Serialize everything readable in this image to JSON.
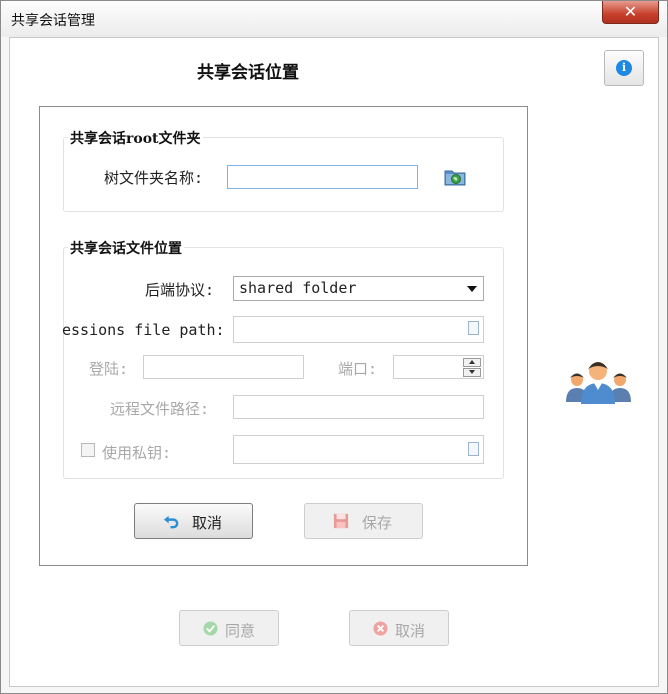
{
  "window": {
    "title": "共享会话管理",
    "close_glyph": "✕"
  },
  "heading": "共享会话位置",
  "info_button": {
    "icon": "info-icon",
    "glyph": "i"
  },
  "root_group": {
    "legend": "共享会话root文件夹",
    "tree_label": "树文件夹名称:",
    "tree_value": "",
    "browse_icon": "folder-globe-icon"
  },
  "location_group": {
    "legend": "共享会话文件位置",
    "backend_label": "后端协议:",
    "backend_value": "shared folder",
    "path_label": "essions file path:",
    "path_value": "",
    "login_label": "登陆:",
    "login_value": "",
    "port_label": "端口:",
    "port_value": "",
    "remote_label": "远程文件路径:",
    "remote_value": "",
    "key_label": "使用私钥:",
    "key_checked": false,
    "key_value": ""
  },
  "panel_buttons": {
    "cancel": "取消",
    "save": "保存"
  },
  "footer_buttons": {
    "agree": "同意",
    "cancel": "取消"
  },
  "colors": {
    "accent": "#1e88e5",
    "undo": "#2a8fd6",
    "save": "#d9534f",
    "ok": "#4caf50",
    "no": "#e53935"
  }
}
